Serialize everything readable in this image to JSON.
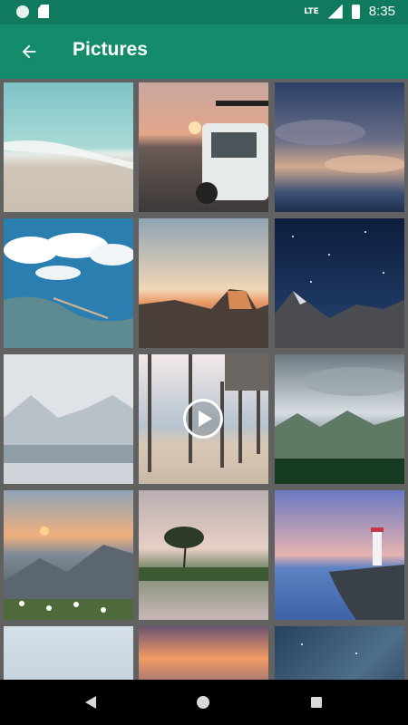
{
  "status_bar": {
    "network": "LTE",
    "time": "8:35"
  },
  "app_bar": {
    "title": "Pictures",
    "back_icon": "arrow-left-icon"
  },
  "gallery": {
    "items": [
      {
        "subject": "beach waves",
        "type": "image"
      },
      {
        "subject": "jeep at sunset",
        "type": "image"
      },
      {
        "subject": "cloudy sky",
        "type": "image"
      },
      {
        "subject": "aerial bay with clouds",
        "type": "image"
      },
      {
        "subject": "half dome sunset",
        "type": "image"
      },
      {
        "subject": "starry night mountains",
        "type": "image"
      },
      {
        "subject": "snowy lake",
        "type": "image"
      },
      {
        "subject": "pier on beach",
        "type": "video"
      },
      {
        "subject": "mountain valley",
        "type": "image"
      },
      {
        "subject": "mountain sunrise with flowers",
        "type": "image"
      },
      {
        "subject": "tree reflection lake",
        "type": "image"
      },
      {
        "subject": "lighthouse",
        "type": "image"
      },
      {
        "subject": "pale sky",
        "type": "image"
      },
      {
        "subject": "sunset over city",
        "type": "image"
      },
      {
        "subject": "milky way",
        "type": "image"
      }
    ]
  },
  "colors": {
    "status_bar": "#0f7a5e",
    "app_bar": "#148b6a",
    "grid_background": "#616161"
  }
}
